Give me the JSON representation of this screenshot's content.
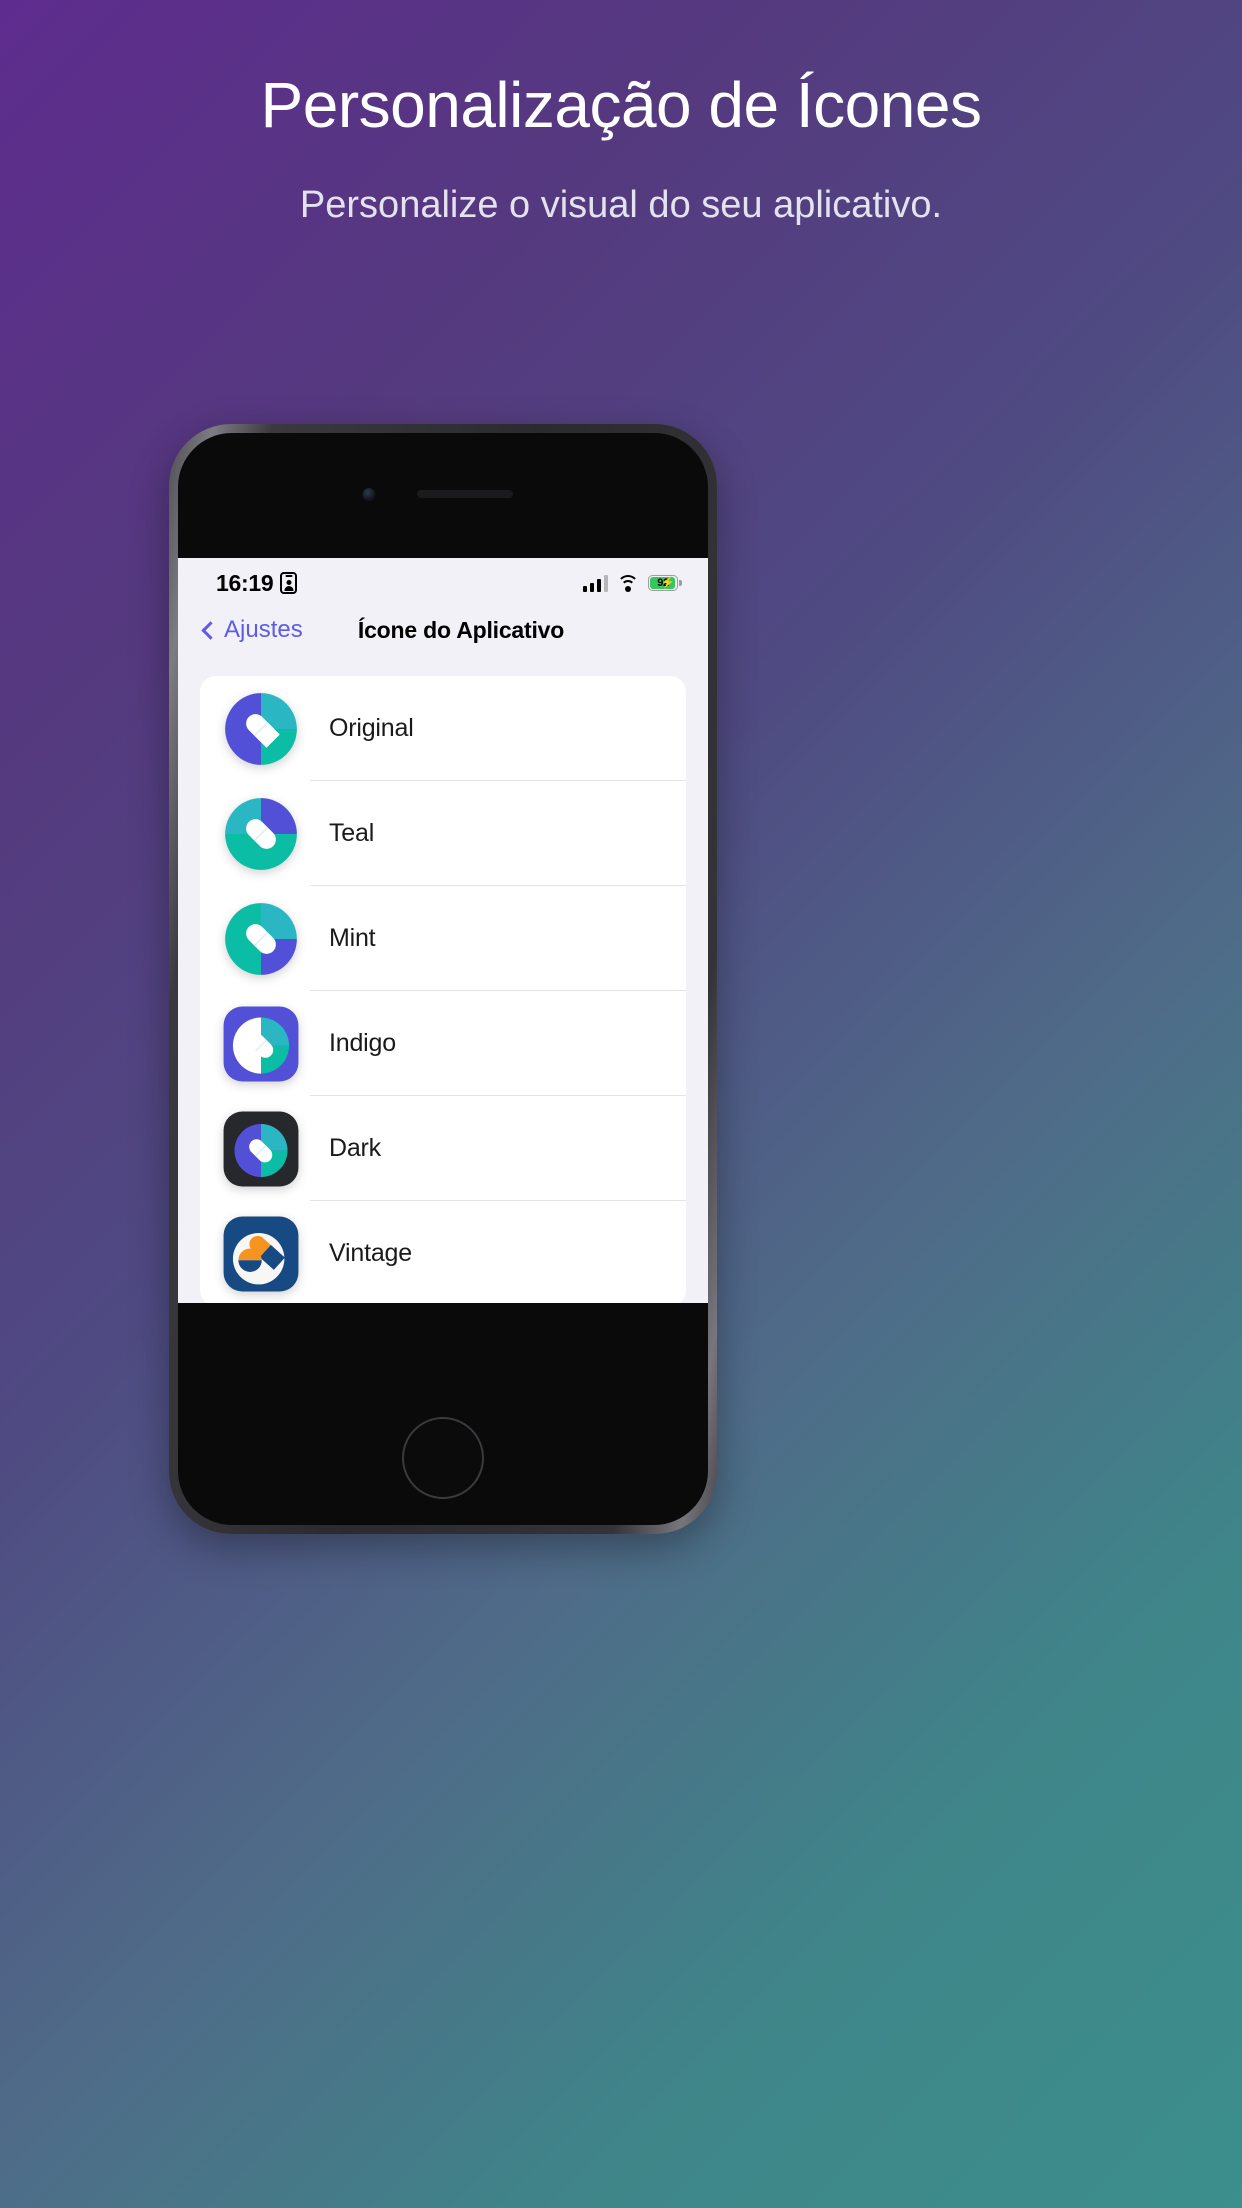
{
  "promo": {
    "title": "Personalização de Ícones",
    "subtitle": "Personalize o visual do seu aplicativo."
  },
  "theme": {
    "bg_gradient_start": "#5e2c8e",
    "bg_gradient_end": "#3c8f8c",
    "accent": "#5e5ce6",
    "battery_green": "#34c759",
    "screen_bg": "#f2f1f7",
    "card_bg": "#ffffff"
  },
  "statusbar": {
    "time": "16:19",
    "faceid_icon": "face-id-card-icon",
    "signal_icon": "cellular-signal-icon",
    "wifi_icon": "wifi-icon",
    "battery_icon": "battery-charging-icon",
    "battery_percent": "92"
  },
  "navbar": {
    "back_icon": "chevron-left-icon",
    "back_label": "Ajustes",
    "title": "Ícone do Aplicativo"
  },
  "icon_list": {
    "items": [
      {
        "label": "Original",
        "style": "circle",
        "icon_name": "app-icon-original"
      },
      {
        "label": "Teal",
        "style": "circle",
        "icon_name": "app-icon-teal"
      },
      {
        "label": "Mint",
        "style": "circle",
        "icon_name": "app-icon-mint"
      },
      {
        "label": "Indigo",
        "style": "squircle",
        "icon_name": "app-icon-indigo"
      },
      {
        "label": "Dark",
        "style": "squircle",
        "icon_name": "app-icon-dark"
      },
      {
        "label": "Vintage",
        "style": "squircle",
        "icon_name": "app-icon-vintage"
      }
    ]
  }
}
